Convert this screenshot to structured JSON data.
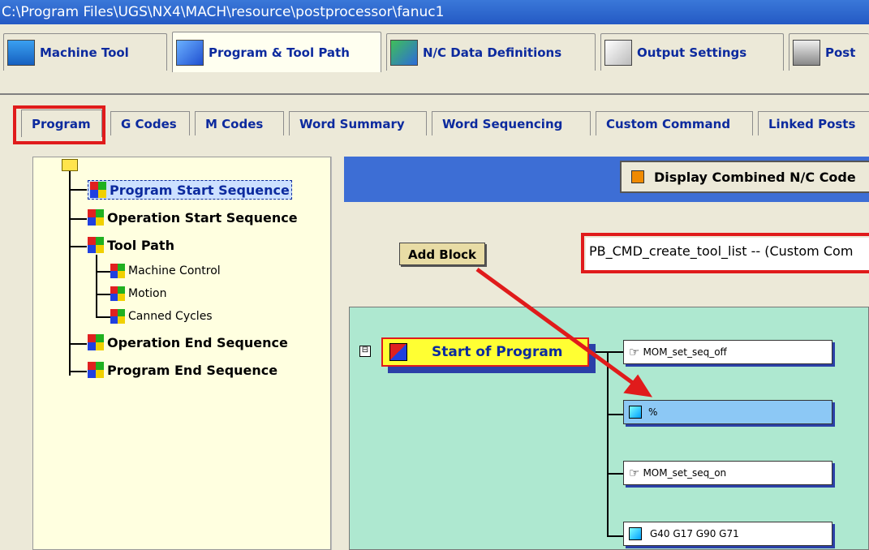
{
  "title_path": "C:\\Program Files\\UGS\\NX4\\MACH\\resource\\postprocessor\\fanuc1",
  "main_tabs": [
    {
      "label": "Machine Tool"
    },
    {
      "label": "Program & Tool Path"
    },
    {
      "label": "N/C Data Definitions"
    },
    {
      "label": "Output Settings"
    },
    {
      "label": "Post"
    }
  ],
  "sub_tabs": [
    {
      "label": "Program"
    },
    {
      "label": "G Codes"
    },
    {
      "label": "M Codes"
    },
    {
      "label": "Word Summary"
    },
    {
      "label": "Word Sequencing"
    },
    {
      "label": "Custom Command"
    },
    {
      "label": "Linked Posts"
    }
  ],
  "tree": {
    "items": [
      {
        "label": "Program Start Sequence"
      },
      {
        "label": "Operation Start Sequence"
      },
      {
        "label": "Tool Path"
      },
      {
        "label": "Machine Control"
      },
      {
        "label": "Motion"
      },
      {
        "label": "Canned Cycles"
      },
      {
        "label": "Operation End Sequence"
      },
      {
        "label": "Program End Sequence"
      }
    ]
  },
  "display_combined": "Display Combined N/C Code",
  "add_block_label": "Add Block",
  "command_field": "PB_CMD_create_tool_list -- (Custom Com",
  "sequence": {
    "start_label": "Start of Program",
    "collapse_glyph": "⊟",
    "blocks": [
      {
        "label": "MOM_set_seq_off",
        "icon": "hand-pointer-icon"
      },
      {
        "label": "%",
        "icon": "cube-icon"
      },
      {
        "label": "MOM_set_seq_on",
        "icon": "hand-pointer-icon"
      },
      {
        "label": "G40 G17 G90 G71",
        "icon": "cube-icon"
      }
    ]
  },
  "colors": {
    "title_blue": "#2459c4",
    "highlight_red": "#e01b1b",
    "tree_bg": "#ffffe0",
    "canvas_bg": "#aee8d0",
    "start_yellow": "#ffff33",
    "selected_block": "#8cc8f5"
  }
}
